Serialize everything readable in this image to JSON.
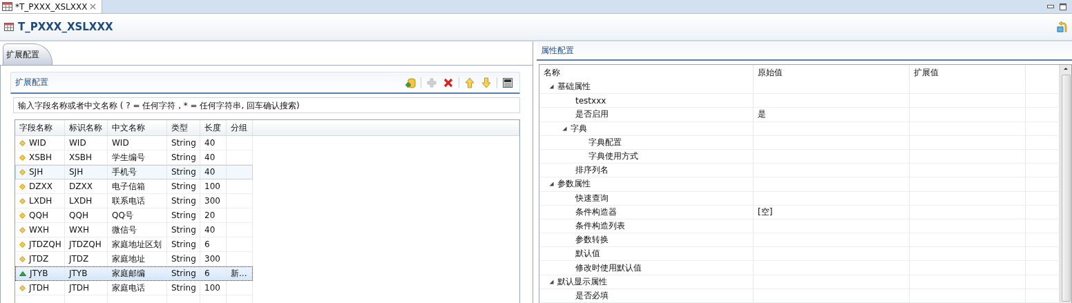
{
  "editor_tab": {
    "label": "*T_PXXX_XSLXXX",
    "selected": true
  },
  "editor_title": "T_PXXX_XSLXXX",
  "left_tab": {
    "label": "扩展配置",
    "selected": true
  },
  "section": {
    "title": "扩展配置",
    "toolbar": [
      {
        "kind": "import",
        "disabled": false
      },
      {
        "kind": "add",
        "disabled": true
      },
      {
        "kind": "delete",
        "disabled": false
      },
      {
        "kind": "up",
        "disabled": false
      },
      {
        "kind": "down",
        "disabled": false
      },
      {
        "kind": "sql",
        "disabled": false
      }
    ],
    "search": {
      "placeholder": "输入字段名称或者中文名称 ( ? = 任何字符 , * = 任何字符串, 回车确认搜索)"
    }
  },
  "table": {
    "columns": [
      "字段名称",
      "标识名称",
      "中文名称",
      "类型",
      "长度",
      "分组"
    ],
    "rows": [
      {
        "kind": "field",
        "selected": false,
        "hovered": false,
        "cells": [
          "WID",
          "WID",
          "WID",
          "String",
          "40",
          ""
        ]
      },
      {
        "kind": "field",
        "selected": false,
        "hovered": false,
        "cells": [
          "XSBH",
          "XSBH",
          "学生编号",
          "String",
          "40",
          ""
        ]
      },
      {
        "kind": "field",
        "selected": false,
        "hovered": true,
        "cells": [
          "SJH",
          "SJH",
          "手机号",
          "String",
          "40",
          ""
        ]
      },
      {
        "kind": "field",
        "selected": false,
        "hovered": false,
        "cells": [
          "DZXX",
          "DZXX",
          "电子信箱",
          "String",
          "100",
          ""
        ]
      },
      {
        "kind": "field",
        "selected": false,
        "hovered": false,
        "cells": [
          "LXDH",
          "LXDH",
          "联系电话",
          "String",
          "300",
          ""
        ]
      },
      {
        "kind": "field",
        "selected": false,
        "hovered": false,
        "cells": [
          "QQH",
          "QQH",
          "QQ号",
          "String",
          "20",
          ""
        ]
      },
      {
        "kind": "field",
        "selected": false,
        "hovered": false,
        "cells": [
          "WXH",
          "WXH",
          "微信号",
          "String",
          "40",
          ""
        ]
      },
      {
        "kind": "field",
        "selected": false,
        "hovered": false,
        "cells": [
          "JTDZQH",
          "JTDZQH",
          "家庭地址区划",
          "String",
          "6",
          ""
        ]
      },
      {
        "kind": "field",
        "selected": false,
        "hovered": false,
        "cells": [
          "JTDZ",
          "JTDZ",
          "家庭地址",
          "String",
          "300",
          ""
        ]
      },
      {
        "kind": "new",
        "selected": true,
        "hovered": false,
        "cells": [
          "JTYB",
          "JTYB",
          "家庭邮编",
          "String",
          "6",
          "新..."
        ]
      },
      {
        "kind": "field",
        "selected": false,
        "hovered": false,
        "cells": [
          "JTDH",
          "JTDH",
          "家庭电话",
          "String",
          "100",
          ""
        ]
      }
    ]
  },
  "properties": {
    "title": "属性配置",
    "columns": [
      "名称",
      "原始值",
      "扩展值"
    ],
    "tree": [
      {
        "name": "基础属性",
        "expanded": true,
        "children": [
          {
            "name": "testxxx"
          },
          {
            "name": "是否启用",
            "original": "是"
          },
          {
            "name": "字典",
            "expanded": true,
            "children": [
              {
                "name": "字典配置"
              },
              {
                "name": "字典使用方式"
              }
            ]
          },
          {
            "name": "排序列名"
          }
        ]
      },
      {
        "name": "参数属性",
        "expanded": true,
        "children": [
          {
            "name": "快速查询"
          },
          {
            "name": "条件构造器",
            "original": "[空]"
          },
          {
            "name": "条件构造列表"
          },
          {
            "name": "参数转换"
          },
          {
            "name": "默认值"
          },
          {
            "name": "修改时使用默认值"
          }
        ]
      },
      {
        "name": "默认显示属性",
        "expanded": true,
        "children": [
          {
            "name": "是否必填"
          }
        ]
      }
    ]
  }
}
